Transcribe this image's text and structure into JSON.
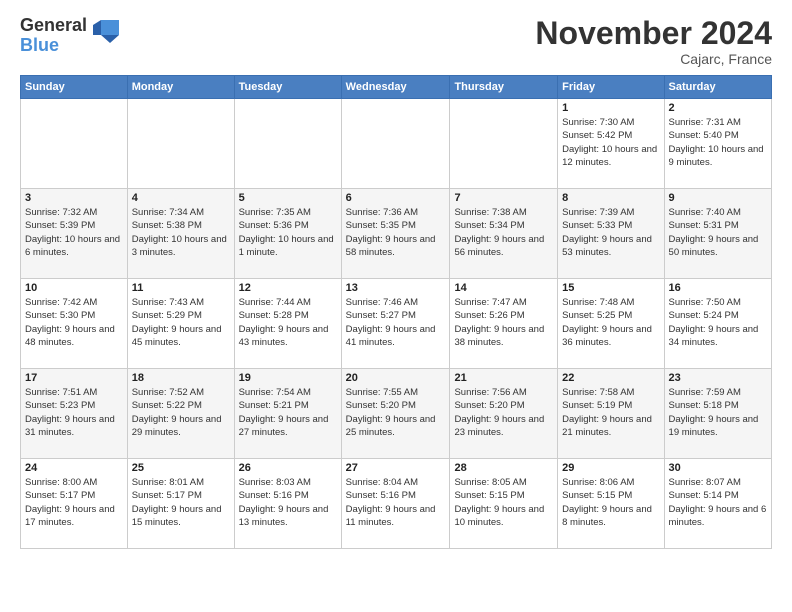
{
  "logo": {
    "general": "General",
    "blue": "Blue"
  },
  "header": {
    "month_title": "November 2024",
    "location": "Cajarc, France"
  },
  "weekdays": [
    "Sunday",
    "Monday",
    "Tuesday",
    "Wednesday",
    "Thursday",
    "Friday",
    "Saturday"
  ],
  "weeks": [
    [
      {
        "day": "",
        "info": ""
      },
      {
        "day": "",
        "info": ""
      },
      {
        "day": "",
        "info": ""
      },
      {
        "day": "",
        "info": ""
      },
      {
        "day": "",
        "info": ""
      },
      {
        "day": "1",
        "info": "Sunrise: 7:30 AM\nSunset: 5:42 PM\nDaylight: 10 hours and 12 minutes."
      },
      {
        "day": "2",
        "info": "Sunrise: 7:31 AM\nSunset: 5:40 PM\nDaylight: 10 hours and 9 minutes."
      }
    ],
    [
      {
        "day": "3",
        "info": "Sunrise: 7:32 AM\nSunset: 5:39 PM\nDaylight: 10 hours and 6 minutes."
      },
      {
        "day": "4",
        "info": "Sunrise: 7:34 AM\nSunset: 5:38 PM\nDaylight: 10 hours and 3 minutes."
      },
      {
        "day": "5",
        "info": "Sunrise: 7:35 AM\nSunset: 5:36 PM\nDaylight: 10 hours and 1 minute."
      },
      {
        "day": "6",
        "info": "Sunrise: 7:36 AM\nSunset: 5:35 PM\nDaylight: 9 hours and 58 minutes."
      },
      {
        "day": "7",
        "info": "Sunrise: 7:38 AM\nSunset: 5:34 PM\nDaylight: 9 hours and 56 minutes."
      },
      {
        "day": "8",
        "info": "Sunrise: 7:39 AM\nSunset: 5:33 PM\nDaylight: 9 hours and 53 minutes."
      },
      {
        "day": "9",
        "info": "Sunrise: 7:40 AM\nSunset: 5:31 PM\nDaylight: 9 hours and 50 minutes."
      }
    ],
    [
      {
        "day": "10",
        "info": "Sunrise: 7:42 AM\nSunset: 5:30 PM\nDaylight: 9 hours and 48 minutes."
      },
      {
        "day": "11",
        "info": "Sunrise: 7:43 AM\nSunset: 5:29 PM\nDaylight: 9 hours and 45 minutes."
      },
      {
        "day": "12",
        "info": "Sunrise: 7:44 AM\nSunset: 5:28 PM\nDaylight: 9 hours and 43 minutes."
      },
      {
        "day": "13",
        "info": "Sunrise: 7:46 AM\nSunset: 5:27 PM\nDaylight: 9 hours and 41 minutes."
      },
      {
        "day": "14",
        "info": "Sunrise: 7:47 AM\nSunset: 5:26 PM\nDaylight: 9 hours and 38 minutes."
      },
      {
        "day": "15",
        "info": "Sunrise: 7:48 AM\nSunset: 5:25 PM\nDaylight: 9 hours and 36 minutes."
      },
      {
        "day": "16",
        "info": "Sunrise: 7:50 AM\nSunset: 5:24 PM\nDaylight: 9 hours and 34 minutes."
      }
    ],
    [
      {
        "day": "17",
        "info": "Sunrise: 7:51 AM\nSunset: 5:23 PM\nDaylight: 9 hours and 31 minutes."
      },
      {
        "day": "18",
        "info": "Sunrise: 7:52 AM\nSunset: 5:22 PM\nDaylight: 9 hours and 29 minutes."
      },
      {
        "day": "19",
        "info": "Sunrise: 7:54 AM\nSunset: 5:21 PM\nDaylight: 9 hours and 27 minutes."
      },
      {
        "day": "20",
        "info": "Sunrise: 7:55 AM\nSunset: 5:20 PM\nDaylight: 9 hours and 25 minutes."
      },
      {
        "day": "21",
        "info": "Sunrise: 7:56 AM\nSunset: 5:20 PM\nDaylight: 9 hours and 23 minutes."
      },
      {
        "day": "22",
        "info": "Sunrise: 7:58 AM\nSunset: 5:19 PM\nDaylight: 9 hours and 21 minutes."
      },
      {
        "day": "23",
        "info": "Sunrise: 7:59 AM\nSunset: 5:18 PM\nDaylight: 9 hours and 19 minutes."
      }
    ],
    [
      {
        "day": "24",
        "info": "Sunrise: 8:00 AM\nSunset: 5:17 PM\nDaylight: 9 hours and 17 minutes."
      },
      {
        "day": "25",
        "info": "Sunrise: 8:01 AM\nSunset: 5:17 PM\nDaylight: 9 hours and 15 minutes."
      },
      {
        "day": "26",
        "info": "Sunrise: 8:03 AM\nSunset: 5:16 PM\nDaylight: 9 hours and 13 minutes."
      },
      {
        "day": "27",
        "info": "Sunrise: 8:04 AM\nSunset: 5:16 PM\nDaylight: 9 hours and 11 minutes."
      },
      {
        "day": "28",
        "info": "Sunrise: 8:05 AM\nSunset: 5:15 PM\nDaylight: 9 hours and 10 minutes."
      },
      {
        "day": "29",
        "info": "Sunrise: 8:06 AM\nSunset: 5:15 PM\nDaylight: 9 hours and 8 minutes."
      },
      {
        "day": "30",
        "info": "Sunrise: 8:07 AM\nSunset: 5:14 PM\nDaylight: 9 hours and 6 minutes."
      }
    ]
  ]
}
